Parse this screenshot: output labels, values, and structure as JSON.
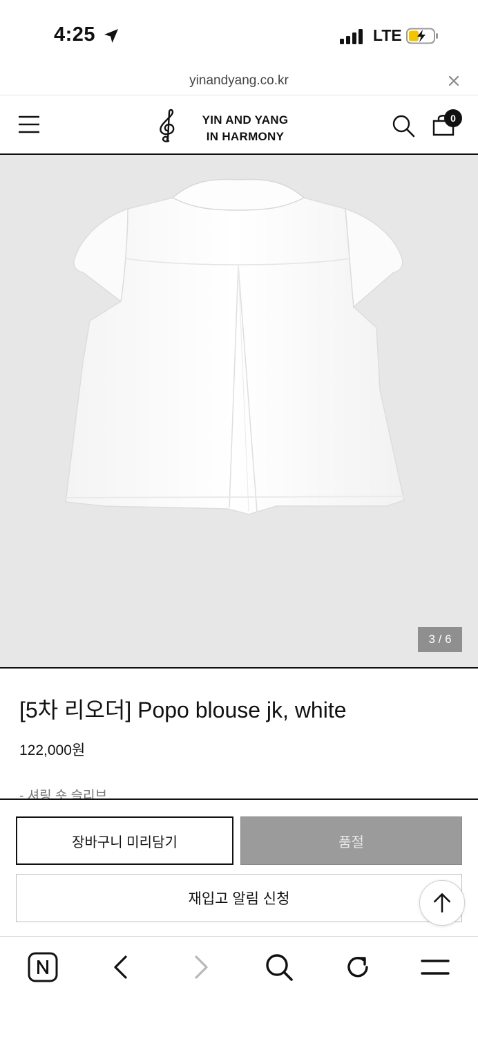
{
  "status_bar": {
    "time": "4:25",
    "network": "LTE",
    "icons": [
      "location-arrow-icon",
      "signal-icon",
      "battery-charging-icon"
    ]
  },
  "url_bar": {
    "url": "yinandyang.co.kr",
    "close_icon": "close-icon"
  },
  "header": {
    "logo_line1": "YIN AND YANG",
    "logo_line2": "IN HARMONY",
    "cart_count": "0",
    "icons": [
      "menu-icon",
      "treble-clef-logo",
      "search-icon",
      "shopping-bag-icon"
    ]
  },
  "gallery": {
    "counter": "3 / 6",
    "current": 3,
    "total": 6,
    "image": "white-blouse-back-view"
  },
  "product": {
    "title": "[5차 리오더] Popo blouse jk, white",
    "price": "122,000원",
    "note": "- 셔링 숏 슬리브"
  },
  "actions": {
    "cart_label": "장바구니 미리담기",
    "soldout_label": "품절",
    "restock_label": "재입고 알림 신청",
    "top_icon": "arrow-up-icon"
  },
  "browser_toolbar": {
    "icons": [
      "naver-icon",
      "back-icon",
      "forward-icon",
      "search-icon",
      "refresh-icon",
      "menu-icon"
    ]
  },
  "colors": {
    "text": "#111111",
    "gallery_bg": "#e7e7e7",
    "soldout_bg": "#9b9b9b",
    "counter_bg": "#8f8f8f",
    "note": "#777777"
  }
}
